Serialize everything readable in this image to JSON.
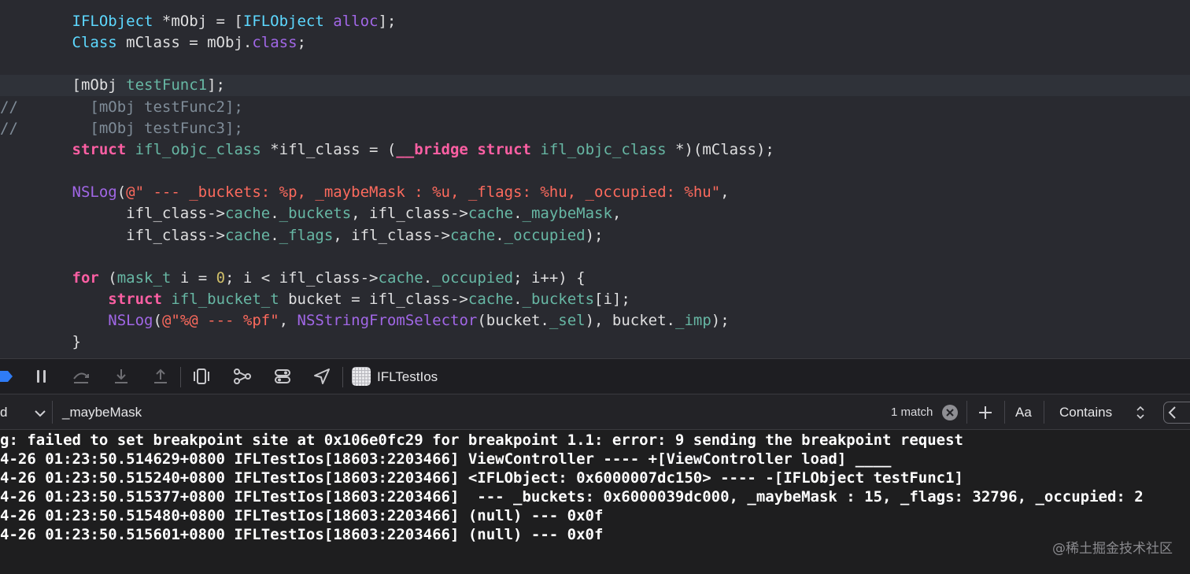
{
  "editor": {
    "lines": [
      [
        {
          "t": "        ",
          "c": "pln"
        },
        {
          "t": "IFLObject",
          "c": "type"
        },
        {
          "t": " *mObj = [",
          "c": "pln"
        },
        {
          "t": "IFLObject",
          "c": "type"
        },
        {
          "t": " ",
          "c": "pln"
        },
        {
          "t": "alloc",
          "c": "meth"
        },
        {
          "t": "];",
          "c": "pln"
        }
      ],
      [
        {
          "t": "        ",
          "c": "pln"
        },
        {
          "t": "Class",
          "c": "type"
        },
        {
          "t": " mClass = mObj.",
          "c": "pln"
        },
        {
          "t": "class",
          "c": "meth"
        },
        {
          "t": ";",
          "c": "pln"
        }
      ],
      [],
      [
        {
          "t": "        [mObj ",
          "c": "pln"
        },
        {
          "t": "testFunc1",
          "c": "proj"
        },
        {
          "t": "];",
          "c": "pln"
        }
      ],
      [
        {
          "t": "//        [mObj testFunc2];",
          "c": "cmt"
        }
      ],
      [
        {
          "t": "//        [mObj testFunc3];",
          "c": "cmt"
        }
      ],
      [
        {
          "t": "        ",
          "c": "pln"
        },
        {
          "t": "struct",
          "c": "kw"
        },
        {
          "t": " ",
          "c": "pln"
        },
        {
          "t": "ifl_objc_class",
          "c": "proj"
        },
        {
          "t": " *ifl_class = (",
          "c": "pln"
        },
        {
          "t": "__bridge",
          "c": "kw"
        },
        {
          "t": " ",
          "c": "pln"
        },
        {
          "t": "struct",
          "c": "kw"
        },
        {
          "t": " ",
          "c": "pln"
        },
        {
          "t": "ifl_objc_class",
          "c": "proj"
        },
        {
          "t": " *)(mClass);",
          "c": "pln"
        }
      ],
      [],
      [
        {
          "t": "        ",
          "c": "pln"
        },
        {
          "t": "NSLog",
          "c": "meth"
        },
        {
          "t": "(",
          "c": "pln"
        },
        {
          "t": "@\" --- _buckets: %p, _maybeMask : %u, _flags: %hu, _occupied: %hu\"",
          "c": "str"
        },
        {
          "t": ",",
          "c": "pln"
        }
      ],
      [
        {
          "t": "              ifl_class->",
          "c": "pln"
        },
        {
          "t": "cache",
          "c": "proj"
        },
        {
          "t": ".",
          "c": "pln"
        },
        {
          "t": "_buckets",
          "c": "proj"
        },
        {
          "t": ", ifl_class->",
          "c": "pln"
        },
        {
          "t": "cache",
          "c": "proj"
        },
        {
          "t": ".",
          "c": "pln"
        },
        {
          "t": "_maybeMask",
          "c": "proj"
        },
        {
          "t": ",",
          "c": "pln"
        }
      ],
      [
        {
          "t": "              ifl_class->",
          "c": "pln"
        },
        {
          "t": "cache",
          "c": "proj"
        },
        {
          "t": ".",
          "c": "pln"
        },
        {
          "t": "_flags",
          "c": "proj"
        },
        {
          "t": ", ifl_class->",
          "c": "pln"
        },
        {
          "t": "cache",
          "c": "proj"
        },
        {
          "t": ".",
          "c": "pln"
        },
        {
          "t": "_occupied",
          "c": "proj"
        },
        {
          "t": ");",
          "c": "pln"
        }
      ],
      [],
      [
        {
          "t": "        ",
          "c": "pln"
        },
        {
          "t": "for",
          "c": "kw"
        },
        {
          "t": " (",
          "c": "pln"
        },
        {
          "t": "mask_t",
          "c": "proj"
        },
        {
          "t": " i = ",
          "c": "pln"
        },
        {
          "t": "0",
          "c": "num"
        },
        {
          "t": "; i < ifl_class->",
          "c": "pln"
        },
        {
          "t": "cache",
          "c": "proj"
        },
        {
          "t": ".",
          "c": "pln"
        },
        {
          "t": "_occupied",
          "c": "proj"
        },
        {
          "t": "; i++) {",
          "c": "pln"
        }
      ],
      [
        {
          "t": "            ",
          "c": "pln"
        },
        {
          "t": "struct",
          "c": "kw"
        },
        {
          "t": " ",
          "c": "pln"
        },
        {
          "t": "ifl_bucket_t",
          "c": "proj"
        },
        {
          "t": " bucket = ifl_class->",
          "c": "pln"
        },
        {
          "t": "cache",
          "c": "proj"
        },
        {
          "t": ".",
          "c": "pln"
        },
        {
          "t": "_buckets",
          "c": "proj"
        },
        {
          "t": "[i];",
          "c": "pln"
        }
      ],
      [
        {
          "t": "            ",
          "c": "pln"
        },
        {
          "t": "NSLog",
          "c": "meth"
        },
        {
          "t": "(",
          "c": "pln"
        },
        {
          "t": "@\"%@ --- %pf\"",
          "c": "str"
        },
        {
          "t": ", ",
          "c": "pln"
        },
        {
          "t": "NSStringFromSelector",
          "c": "meth"
        },
        {
          "t": "(bucket.",
          "c": "pln"
        },
        {
          "t": "_sel",
          "c": "proj"
        },
        {
          "t": "), bucket.",
          "c": "pln"
        },
        {
          "t": "_imp",
          "c": "proj"
        },
        {
          "t": ");",
          "c": "pln"
        }
      ],
      [
        {
          "t": "        }",
          "c": "pln"
        }
      ]
    ]
  },
  "debug_bar": {
    "scheme_name": "IFLTestIos",
    "buttons": [
      "breakpoints-icon",
      "pause-icon",
      "step-over-icon",
      "step-into-icon",
      "step-out-icon",
      "view-hierarchy-icon",
      "memory-graph-icon",
      "environment-overrides-icon",
      "location-icon"
    ]
  },
  "filter_bar": {
    "scope_fragment": "d",
    "search_value": "_maybeMask",
    "match_count": "1 match",
    "case_label": "Aa",
    "mode_label": "Contains"
  },
  "console": {
    "lines": [
      "g: failed to set breakpoint site at 0x106e0fc29 for breakpoint 1.1: error: 9 sending the breakpoint request",
      "4-26 01:23:50.514629+0800 IFLTestIos[18603:2203466] ViewController ---- +[ViewController load] ____",
      "4-26 01:23:50.515240+0800 IFLTestIos[18603:2203466] <IFLObject: 0x6000007dc150> ---- -[IFLObject testFunc1]",
      "4-26 01:23:50.515377+0800 IFLTestIos[18603:2203466]  --- _buckets: 0x6000039dc000, _maybeMask : 15, _flags: 32796, _occupied: 2",
      "4-26 01:23:50.515480+0800 IFLTestIos[18603:2203466] (null) --- 0x0f",
      "4-26 01:23:50.515601+0800 IFLTestIos[18603:2203466] (null) --- 0x0f"
    ],
    "watermark": "@稀土掘金技术社区"
  },
  "colors": {
    "editor_bg": "#292a30",
    "keyword": "#fc5fa3",
    "type": "#5dd8ff",
    "method": "#a167e6",
    "project": "#67b7a4",
    "string": "#fc6a5d",
    "number": "#d0bf69",
    "comment": "#7f8c98"
  }
}
